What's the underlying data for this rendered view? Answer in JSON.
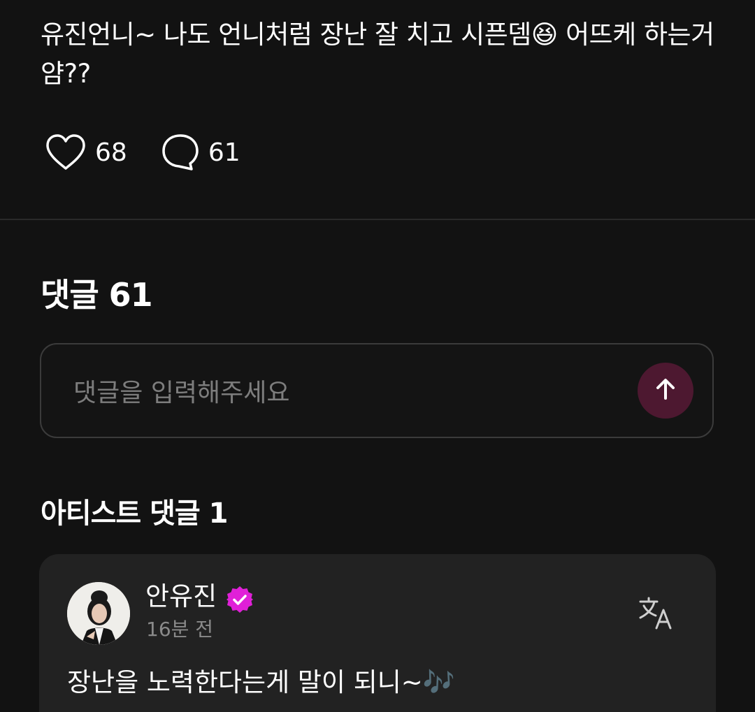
{
  "post": {
    "text": "유진언니~ 나도 언니처럼 장난 잘 치고 시픈뎀😆 어뜨케 하는거얌??",
    "like_count": "68",
    "comment_count": "61"
  },
  "comments": {
    "heading": "댓글 61",
    "input_placeholder": "댓글을 입력해주세요",
    "input_value": ""
  },
  "artist_comments": {
    "heading": "아티스트 댓글 1",
    "items": [
      {
        "author": "안유진",
        "time": "16분 전",
        "text": "장난을 노력한다는게 말이 되니~",
        "emoji": "🎶"
      }
    ]
  },
  "colors": {
    "background": "#121212",
    "card": "#222222",
    "send_button": "#4d1830",
    "verified_badge": "#e020d8"
  },
  "icons": {
    "like": "heart-icon",
    "comment": "speech-bubble-icon",
    "send": "arrow-up-icon",
    "verified": "verified-badge-icon",
    "translate": "translate-icon"
  }
}
